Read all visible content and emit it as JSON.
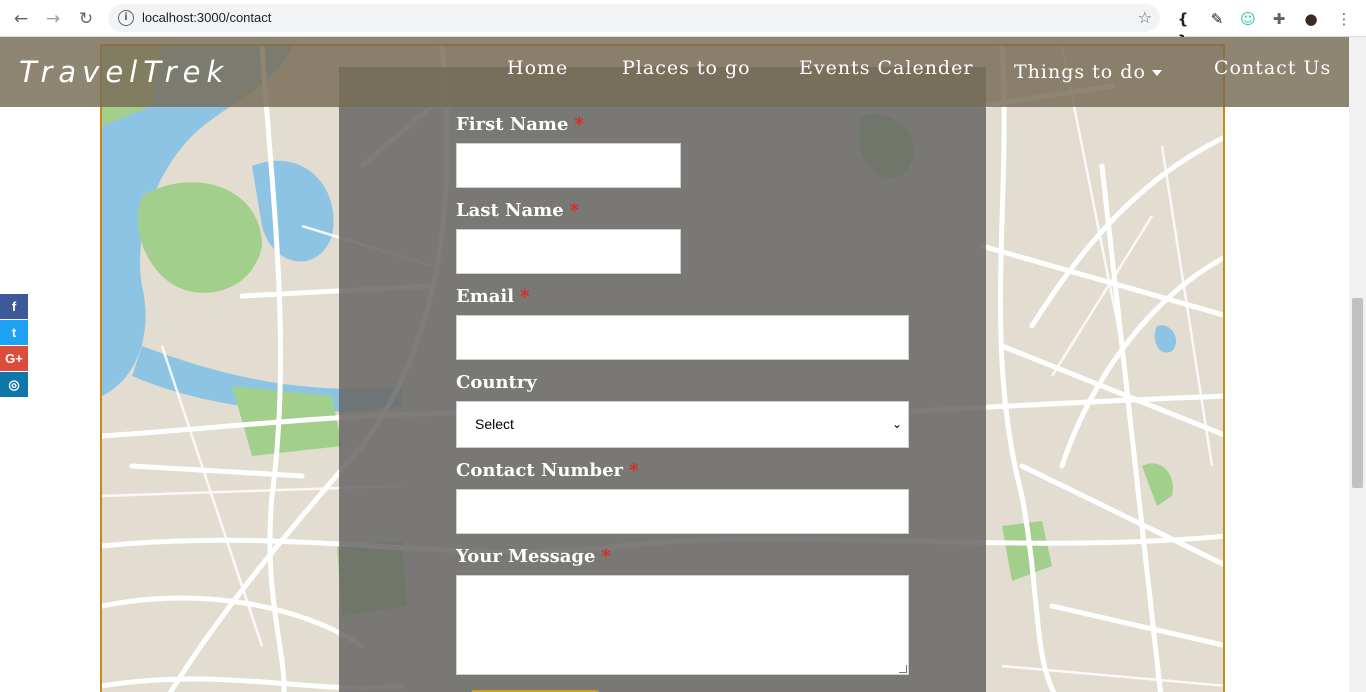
{
  "browser": {
    "url": "localhost:3000/contact",
    "back_icon": "back-arrow-icon",
    "forward_icon": "forward-arrow-icon",
    "reload_icon": "reload-icon",
    "extensions": [
      "{ }",
      "✎",
      "☺",
      "✚",
      "●",
      "⋮"
    ]
  },
  "header": {
    "brand": "TravelTrek",
    "nav": [
      "Home",
      "Places to go",
      "Events Calender",
      "Things to do",
      "Contact Us"
    ]
  },
  "social": [
    "f",
    "t",
    "G+",
    "◎"
  ],
  "form": {
    "first_name_label": "First Name",
    "last_name_label": "Last Name",
    "email_label": "Email",
    "country_label": "Country",
    "country_selected": "Select",
    "contact_number_label": "Contact Number",
    "message_label": "Your Message",
    "required_mark": "*"
  },
  "colors": {
    "accent_border": "#c68a14",
    "required": "#e5251b",
    "header_bg": "#786c57"
  }
}
